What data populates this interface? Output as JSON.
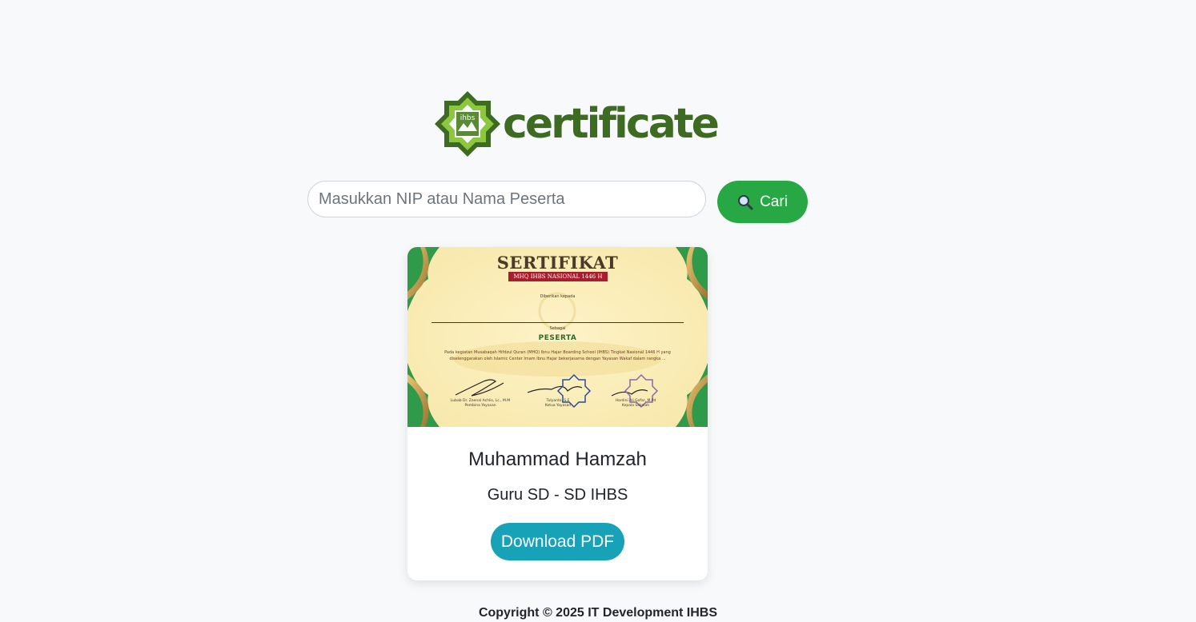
{
  "logo": {
    "text": "certificate",
    "badge_text": "ihbs",
    "colors": {
      "dark_green": "#3d6b22",
      "light_green": "#8dc63f"
    }
  },
  "search": {
    "placeholder": "Masukkan NIP atau Nama Peserta",
    "value": "",
    "button_label": "Cari",
    "button_icon": "magnifier-icon",
    "button_color": "#28a745"
  },
  "certificate": {
    "preview": {
      "title": "SERTIFIKAT",
      "ribbon": "MHQ IHBS NASIONAL 1446 H",
      "given_to": "Diberikan kepada",
      "as_label": "Sebagai",
      "role": "PESERTA",
      "description": "Pada kegiatan Musabaqah Hifdzul Quran (MHQ) Ibnu Hajar Boarding School (IHBS) Tingkat Nasional 1446 H yang diselenggarakan oleh Islamic Center Imam Ibnu Hajar bekerjasama dengan Yayasan Wakaf dalam rangka ...",
      "signatories": [
        {
          "name": "Lubab Dr. Zaenal Achlis, Lc., M.M",
          "title": "Pembina Yayasan"
        },
        {
          "name": "Tulyanto, S.E",
          "title": "Ketua Yayasan"
        },
        {
          "name": "Hardini Ali Gofar, M.Pd",
          "title": "Kepala Sekolah"
        }
      ]
    },
    "name": "Muhammad Hamzah",
    "role": "Guru SD - SD IHBS",
    "download_label": "Download PDF",
    "download_color": "#17a2b8"
  },
  "footer": {
    "text": "Copyright © 2025 IT Development IHBS"
  }
}
